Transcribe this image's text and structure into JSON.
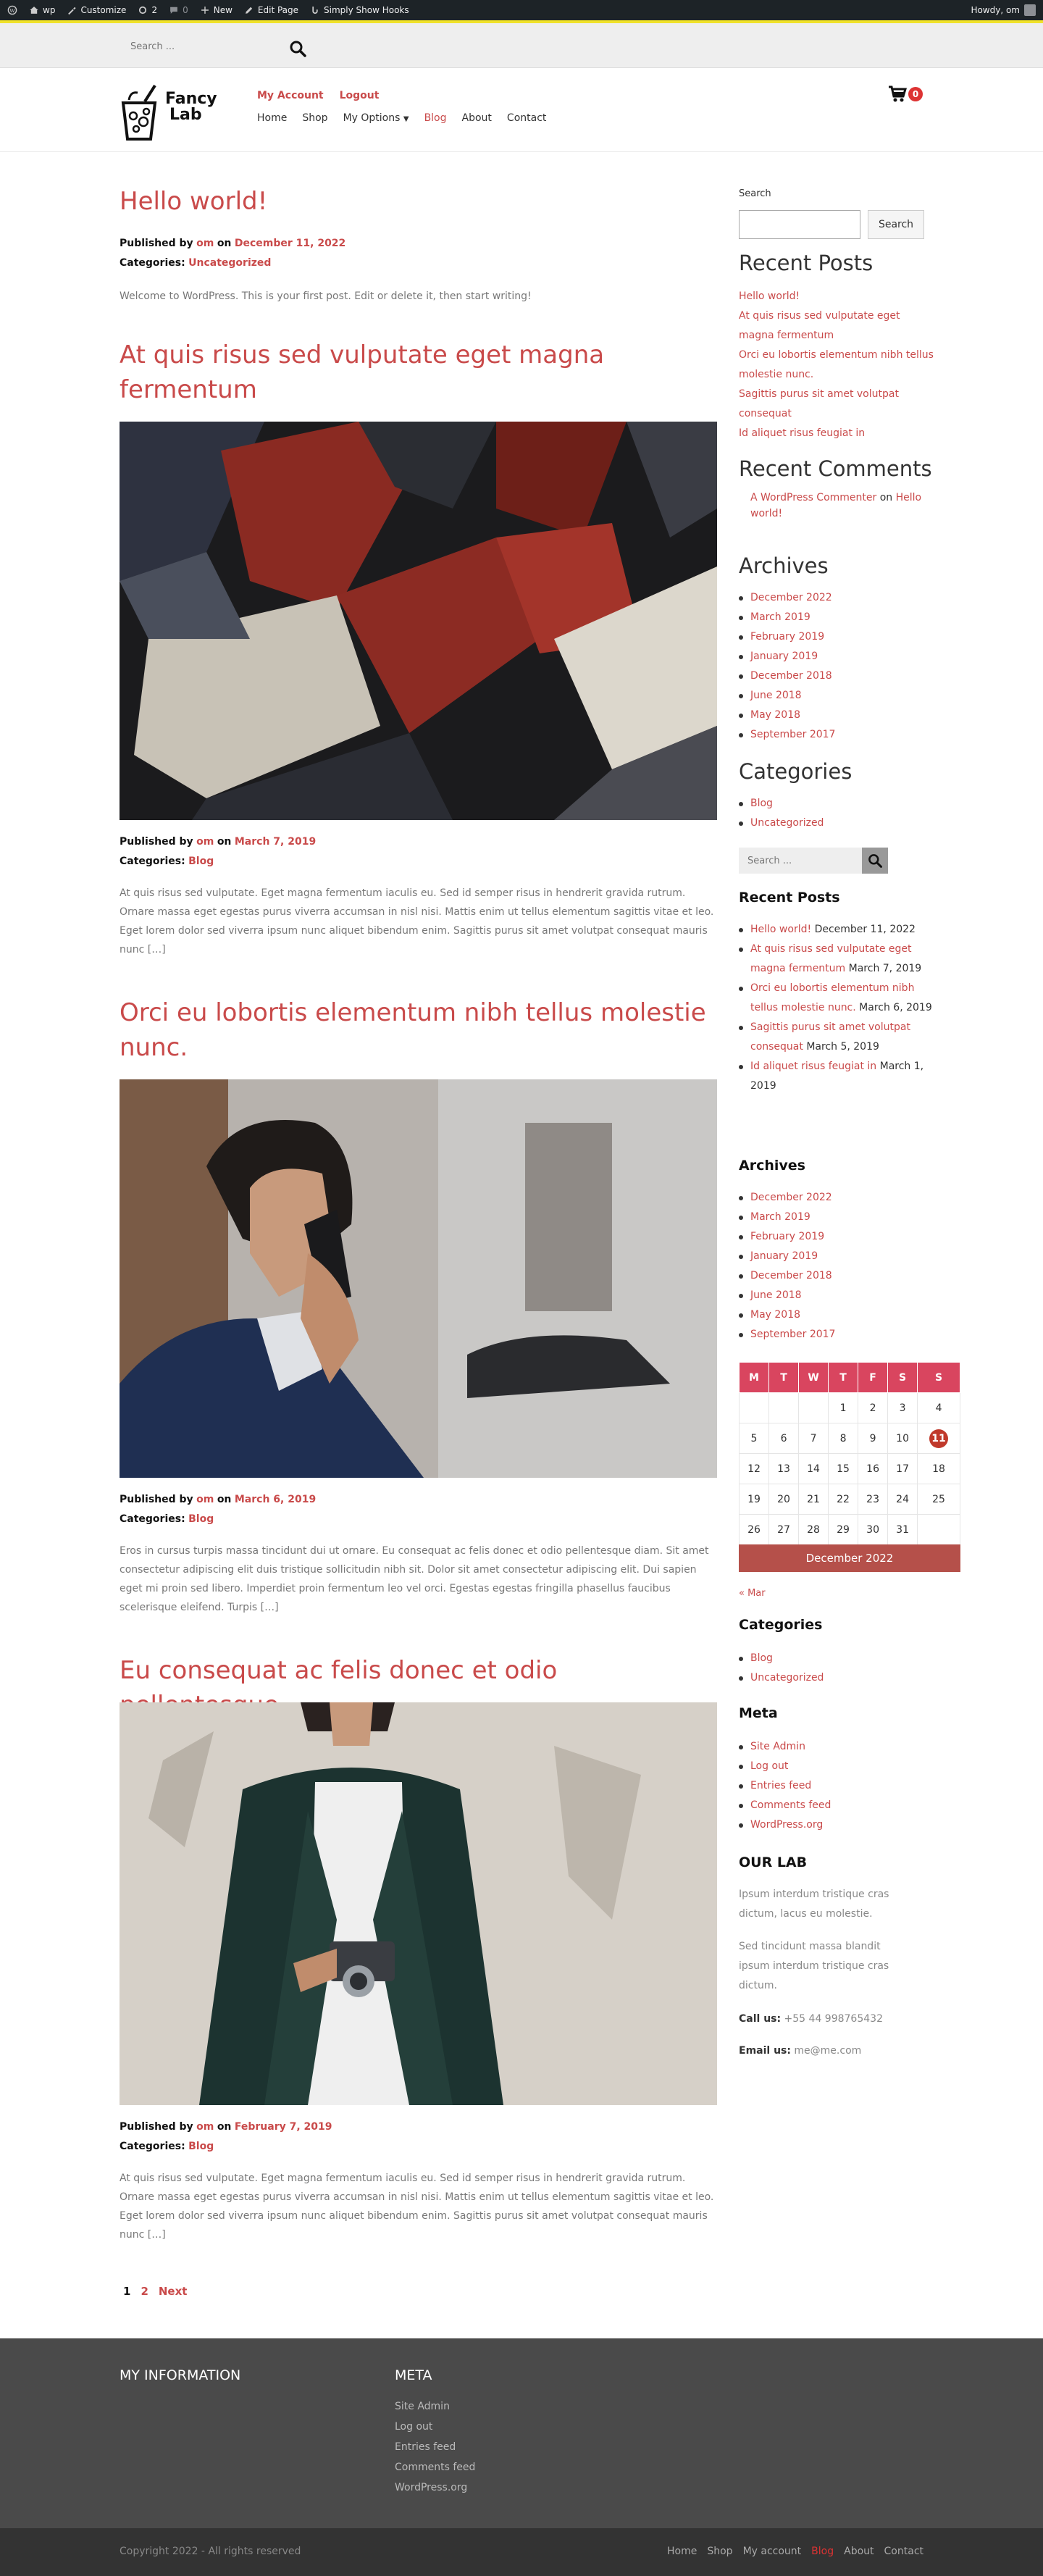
{
  "admin_bar": {
    "site": "wp",
    "customize": "Customize",
    "updates": "2",
    "comments": "0",
    "new": "New",
    "edit_page": "Edit Page",
    "hooks": "Simply Show Hooks",
    "howdy": "Howdy, om"
  },
  "top_search": {
    "placeholder": "Search ..."
  },
  "header": {
    "logo_line1": "Fancy",
    "logo_line2": "Lab",
    "my_account": "My Account",
    "logout": "Logout",
    "nav": [
      "Home",
      "Shop",
      "My Options",
      "Blog",
      "About",
      "Contact"
    ],
    "active_nav": "Blog",
    "cart_count": "0"
  },
  "posts": [
    {
      "title": "Hello world!",
      "published_by_label": "Published by",
      "author": "om",
      "on": "on",
      "date": "December 11, 2022",
      "categories_label": "Categories:",
      "category": "Uncategorized",
      "excerpt": "Welcome to WordPress. This is your first post. Edit or delete it, then start writing!"
    },
    {
      "title": "At quis risus sed vulputate eget magna fermentum",
      "published_by_label": "Published by",
      "author": "om",
      "on": "on",
      "date": "March 7, 2019",
      "categories_label": "Categories:",
      "category": "Blog",
      "excerpt": "At quis risus sed vulputate. Eget magna fermentum iaculis eu. Sed id semper risus in hendrerit gravida rutrum. Ornare massa eget egestas purus viverra accumsan in nisl nisi. Mattis enim ut tellus elementum sagittis vitae et leo. Eget lorem dolor sed viverra ipsum nunc aliquet bibendum enim. Sagittis purus sit amet volutpat consequat mauris nunc […]"
    },
    {
      "title": "Orci eu lobortis elementum nibh tellus molestie nunc.",
      "published_by_label": "Published by",
      "author": "om",
      "on": "on",
      "date": "March 6, 2019",
      "categories_label": "Categories:",
      "category": "Blog",
      "excerpt": "Eros in cursus turpis massa tincidunt dui ut ornare. Eu consequat ac felis donec et odio pellentesque diam. Sit amet consectetur adipiscing elit duis tristique sollicitudin nibh sit. Dolor sit amet consectetur adipiscing elit. Dui sapien eget mi proin sed libero. Imperdiet proin fermentum leo vel orci. Egestas egestas fringilla phasellus faucibus scelerisque eleifend. Turpis […]"
    },
    {
      "title": "Eu consequat ac felis donec et odio pellentesque",
      "published_by_label": "Published by",
      "author": "om",
      "on": "on",
      "date": "February 7, 2019",
      "categories_label": "Categories:",
      "category": "Blog",
      "excerpt": "At quis risus sed vulputate. Eget magna fermentum iaculis eu. Sed id semper risus in hendrerit gravida rutrum. Ornare massa eget egestas purus viverra accumsan in nisl nisi. Mattis enim ut tellus elementum sagittis vitae et leo. Eget lorem dolor sed viverra ipsum nunc aliquet bibendum enim. Sagittis purus sit amet volutpat consequat mauris nunc […]"
    }
  ],
  "pagination": {
    "current": "1",
    "page2": "2",
    "next": "Next"
  },
  "sidebar": {
    "search_label": "Search",
    "search_button": "Search",
    "recent_posts_title": "Recent Posts",
    "recent_posts": [
      "Hello world!",
      "At quis risus sed vulputate eget magna fermentum",
      "Orci eu lobortis elementum nibh tellus molestie nunc.",
      "Sagittis purus sit amet volutpat consequat",
      "Id aliquet risus feugiat in"
    ],
    "recent_comments_title": "Recent Comments",
    "comment_author": "A WordPress Commenter",
    "comment_on": "on",
    "comment_post": "Hello world!",
    "archives_title": "Archives",
    "archives": [
      "December 2022",
      "March 2019",
      "February 2019",
      "January 2019",
      "December 2018",
      "June 2018",
      "May 2018",
      "September 2017"
    ],
    "categories_title": "Categories",
    "categories": [
      "Blog",
      "Uncategorized"
    ],
    "search2_placeholder": "Search ...",
    "recent_posts2_title": "Recent Posts",
    "recent_posts2": [
      {
        "title": "Hello world!",
        "date": "December 11, 2022"
      },
      {
        "title": "At quis risus sed vulputate eget magna fermentum",
        "date": "March 7, 2019"
      },
      {
        "title": "Orci eu lobortis elementum nibh tellus molestie nunc.",
        "date": "March 6, 2019"
      },
      {
        "title": "Sagittis purus sit amet volutpat consequat",
        "date": "March 5, 2019"
      },
      {
        "title": "Id aliquet risus feugiat in",
        "date": "March 1, 2019"
      }
    ],
    "archives2_title": "Archives",
    "calendar": {
      "days": [
        "M",
        "T",
        "W",
        "T",
        "F",
        "S",
        "S"
      ],
      "weeks": [
        [
          "",
          "",
          "",
          "1",
          "2",
          "3",
          "4"
        ],
        [
          "5",
          "6",
          "7",
          "8",
          "9",
          "10",
          "11"
        ],
        [
          "12",
          "13",
          "14",
          "15",
          "16",
          "17",
          "18"
        ],
        [
          "19",
          "20",
          "21",
          "22",
          "23",
          "24",
          "25"
        ],
        [
          "26",
          "27",
          "28",
          "29",
          "30",
          "31",
          ""
        ]
      ],
      "today": "11",
      "caption": "December 2022",
      "prev": "« Mar"
    },
    "categories2_title": "Categories",
    "meta_title": "Meta",
    "meta": [
      "Site Admin",
      "Log out",
      "Entries feed",
      "Comments feed",
      "WordPress.org"
    ],
    "our_lab_title": "OUR LAB",
    "our_lab_p1": "Ipsum interdum tristique cras dictum, lacus eu molestie.",
    "our_lab_p2": "Sed tincidunt massa blandit ipsum interdum tristique cras dictum.",
    "call_label": "Call us:",
    "call_value": "+55 44 998765432",
    "email_label": "Email us:",
    "email_value": "me@me.com"
  },
  "footer": {
    "my_info_title": "MY INFORMATION",
    "meta_title": "META",
    "meta_links": [
      "Site Admin",
      "Log out",
      "Entries feed",
      "Comments feed",
      "WordPress.org"
    ],
    "copyright": "Copyright 2022 - All rights reserved",
    "nav": [
      "Home",
      "Shop",
      "My account",
      "Blog",
      "About",
      "Contact"
    ],
    "active": "Blog"
  },
  "colors": {
    "accent": "#c94a4a",
    "calendar_header": "#d9455f",
    "footer_bg": "#4a4a4a",
    "admin_bar": "#1d2327"
  }
}
